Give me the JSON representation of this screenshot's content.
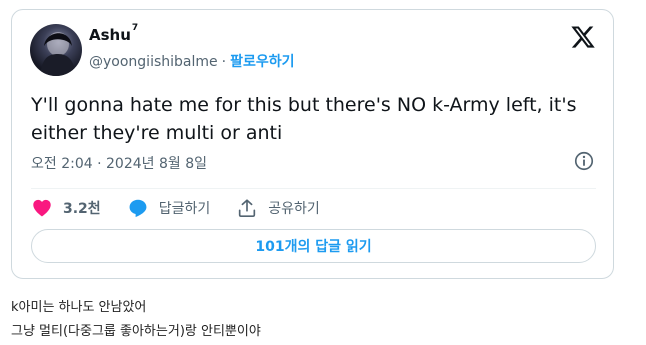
{
  "tweet": {
    "display_name": "Ashu",
    "name_superscript": "7",
    "handle": "@yoongiishibalme",
    "separator": "·",
    "follow_label": "팔로우하기",
    "text": "Y'll gonna hate me for this but there's NO k-Army left, it's either they're multi or anti",
    "timestamp": "오전 2:04 · 2024년 8월 8일",
    "likes_count": "3.2천",
    "reply_label": "답글하기",
    "share_label": "공유하기",
    "read_replies_label": "101개의 답글 읽기",
    "icons": [
      "avatar",
      "x-logo-icon",
      "info-icon",
      "heart-icon",
      "reply-bubble-icon",
      "share-icon"
    ],
    "colors": {
      "accent": "#1d9bf0",
      "like": "#f91880",
      "text": "#0f1419",
      "muted": "#536471",
      "border": "#cfd9de"
    }
  },
  "comment": {
    "line1": "k아미는 하나도 안남았어",
    "line2": "그냥 멀티(다중그룹 좋아하는거)랑 안티뿐이야"
  }
}
